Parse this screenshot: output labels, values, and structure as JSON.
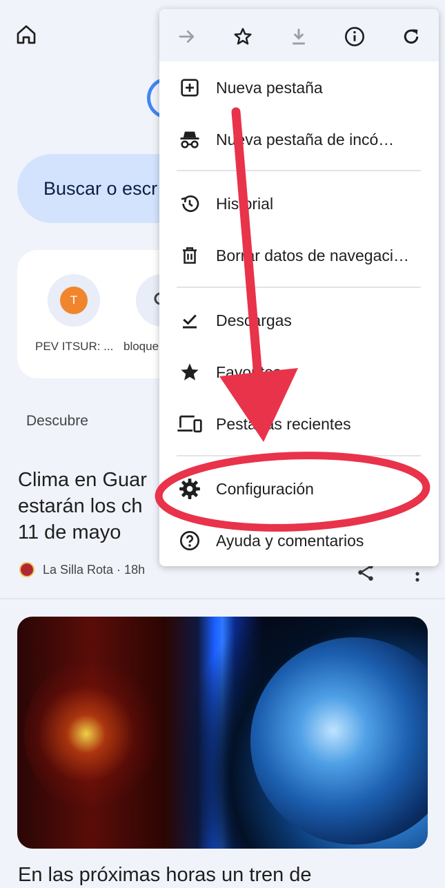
{
  "background_page": {
    "search_placeholder": "Buscar o escr",
    "shortcuts": [
      {
        "label": "PEV ITSUR: ...",
        "avatar_letter": "T"
      },
      {
        "label": "bloque"
      }
    ],
    "discover_label": "Descubre",
    "article1": {
      "title_lines": [
        "Clima en Guar",
        "estarán los ch",
        "11 de mayo"
      ],
      "source": "La Silla Rota · 18h"
    },
    "article2": {
      "title": "En las próximas horas un tren de"
    }
  },
  "menu": {
    "toolbar": [
      {
        "icon": "forward-arrow-icon",
        "enabled": false
      },
      {
        "icon": "star-outline-icon",
        "enabled": true
      },
      {
        "icon": "download-icon",
        "enabled": false
      },
      {
        "icon": "info-icon",
        "enabled": true
      },
      {
        "icon": "reload-icon",
        "enabled": true
      }
    ],
    "items": [
      {
        "label": "Nueva pestaña",
        "icon": "new-tab-icon"
      },
      {
        "label": "Nueva pestaña de incó…",
        "icon": "incognito-icon"
      },
      {
        "label": "Historial",
        "icon": "history-icon"
      },
      {
        "label": "Borrar datos de navegaci…",
        "icon": "trash-icon"
      },
      {
        "label": "Descargas",
        "icon": "downloads-check-icon"
      },
      {
        "label": "Favoritos",
        "icon": "star-filled-icon"
      },
      {
        "label": "Pestañas recientes",
        "icon": "devices-icon"
      },
      {
        "label": "Configuración",
        "icon": "gear-icon"
      },
      {
        "label": "Ayuda y comentarios",
        "icon": "help-icon"
      }
    ]
  },
  "colors": {
    "page_bg": "#f0f3fa",
    "search_bg": "#d3e3fd",
    "annotation_red": "#e8334a",
    "avatar_orange": "#f0852d"
  }
}
